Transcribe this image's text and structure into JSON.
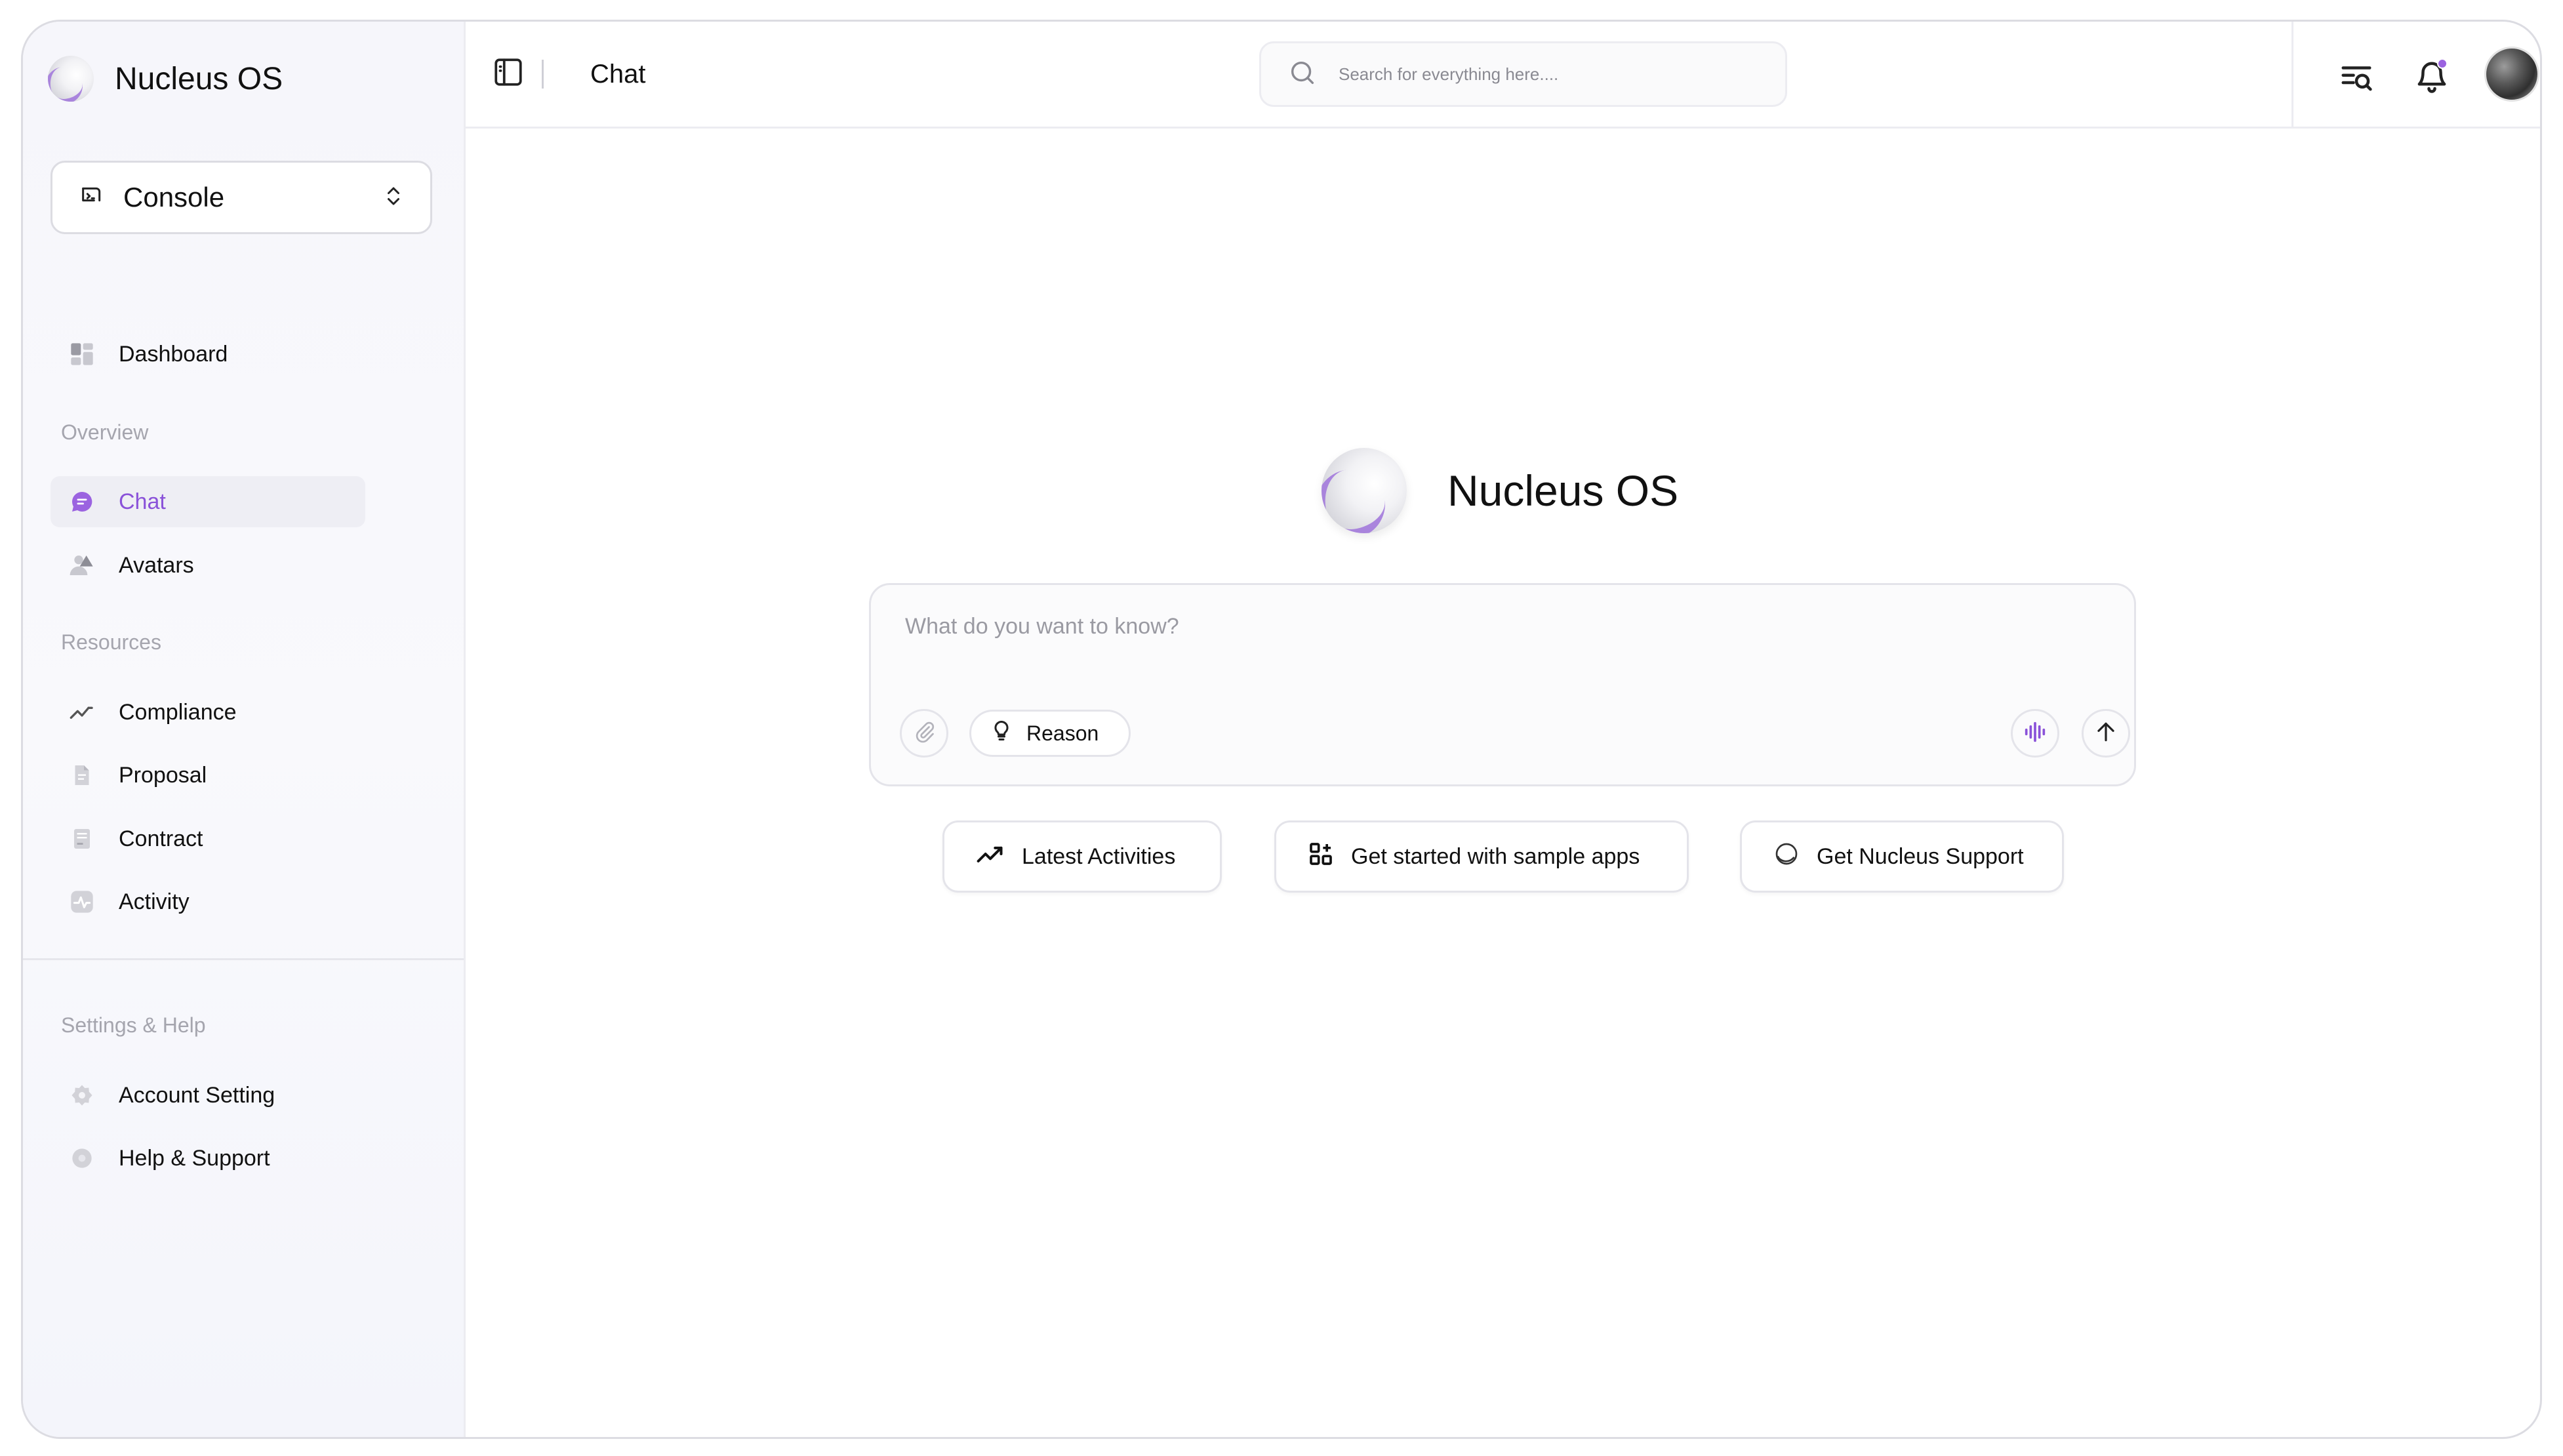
{
  "app": {
    "name": "Nucleus OS"
  },
  "workspace": {
    "selected": "Console"
  },
  "sidebar": {
    "dashboard": "Dashboard",
    "sections": {
      "overview": "Overview",
      "resources": "Resources",
      "settings": "Settings & Help"
    },
    "overview_items": [
      "Chat",
      "Avatars"
    ],
    "resource_items": [
      "Compliance",
      "Proposal",
      "Contract",
      "Activity"
    ],
    "settings_items": [
      "Account Setting",
      "Help & Support"
    ],
    "active_item": "Chat"
  },
  "header": {
    "title": "Chat",
    "search_placeholder": "Search for everything here....",
    "icons": [
      "sidebar-toggle-icon",
      "search-list-icon",
      "bell-icon",
      "user-avatar"
    ]
  },
  "main": {
    "hero_title": "Nucleus OS",
    "prompt_placeholder": "What do you want to know?",
    "reason_label": "Reason",
    "suggestions": [
      {
        "label": "Latest Activities",
        "icon": "trend-icon"
      },
      {
        "label": "Get started with sample apps",
        "icon": "apps-grid-icon"
      },
      {
        "label": "Get Nucleus Support",
        "icon": "nucleus-icon"
      }
    ]
  },
  "colors": {
    "accent": "#8a52d9",
    "active_bg": "#eeeef4",
    "border": "#e4e4ea",
    "muted_text": "#a5a5ae",
    "notification_dot": "#9b63e0"
  }
}
